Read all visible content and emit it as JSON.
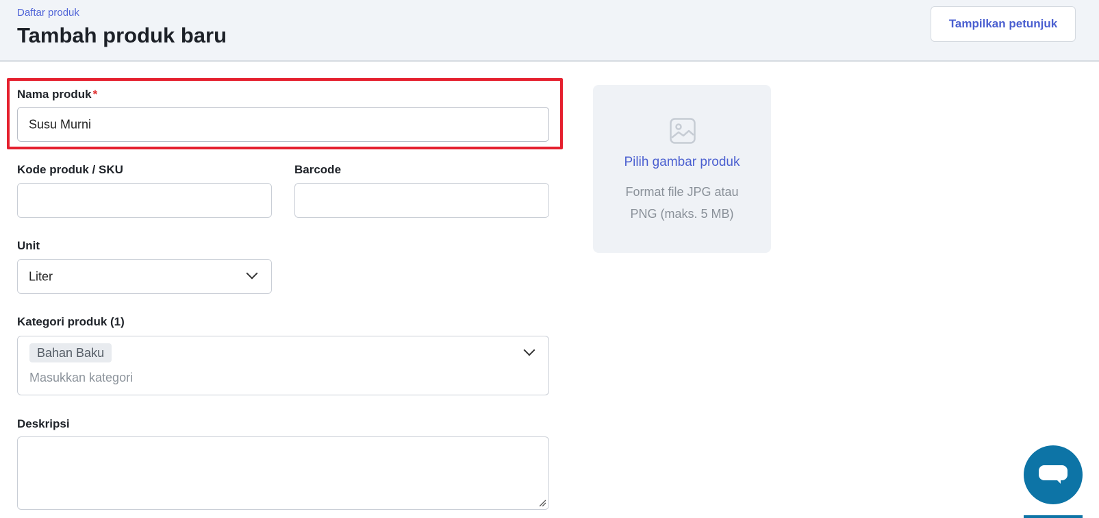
{
  "header": {
    "breadcrumb": "Daftar produk",
    "title": "Tambah produk baru",
    "guide_button": "Tampilkan petunjuk"
  },
  "form": {
    "name": {
      "label": "Nama produk",
      "required_mark": "*",
      "value": "Susu Murni"
    },
    "sku": {
      "label": "Kode produk / SKU",
      "value": ""
    },
    "barcode": {
      "label": "Barcode",
      "value": ""
    },
    "unit": {
      "label": "Unit",
      "value": "Liter"
    },
    "category": {
      "label": "Kategori produk (1)",
      "tags": [
        "Bahan Baku"
      ],
      "placeholder": "Masukkan kategori"
    },
    "description": {
      "label": "Deskripsi",
      "value": ""
    }
  },
  "upload": {
    "link": "Pilih gambar produk",
    "hint": "Format file JPG atau PNG (maks. 5 MB)",
    "icon": "image-icon"
  },
  "chat": {
    "icon": "chat-icon"
  },
  "colors": {
    "accent": "#4a5fd0",
    "highlight": "#e5202e",
    "chat": "#0d74a6"
  }
}
